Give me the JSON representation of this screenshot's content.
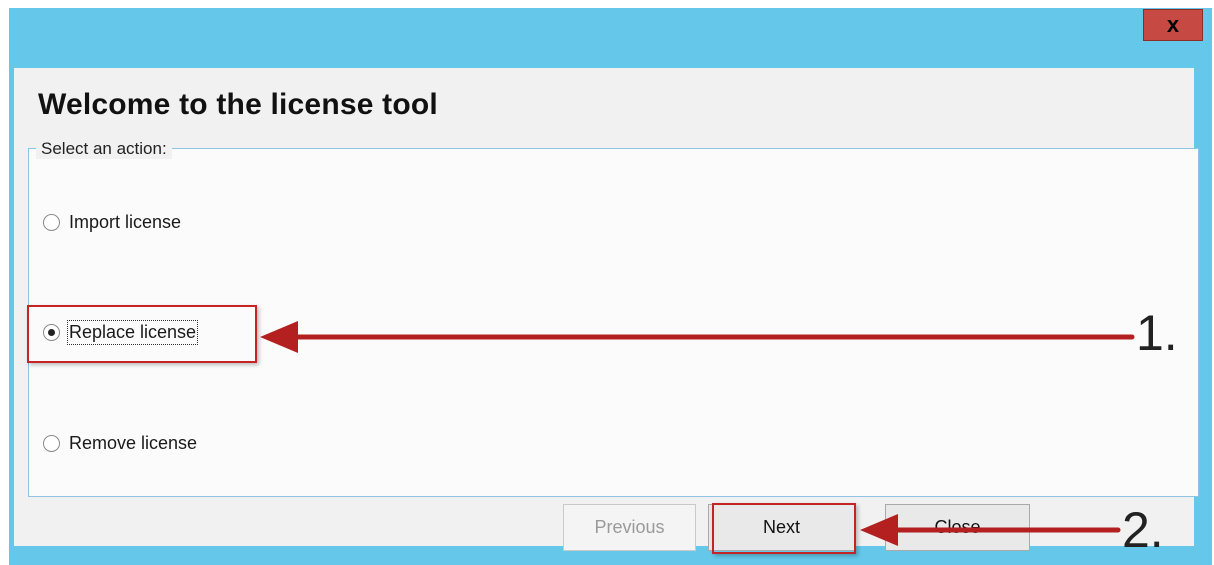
{
  "window": {
    "title": "Welcome to the license tool",
    "close_glyph": "x"
  },
  "group": {
    "label": "Select an action:"
  },
  "options": [
    {
      "label": "Import license",
      "selected": false
    },
    {
      "label": "Replace license",
      "selected": true
    },
    {
      "label": "Remove license",
      "selected": false
    }
  ],
  "buttons": {
    "previous": "Previous",
    "next": "Next",
    "close": "Close"
  },
  "annotations": {
    "step1": "1.",
    "step2": "2.",
    "color": "#c62424"
  },
  "colors": {
    "window_frame": "#65c8ea",
    "close_button": "#c64a43"
  }
}
